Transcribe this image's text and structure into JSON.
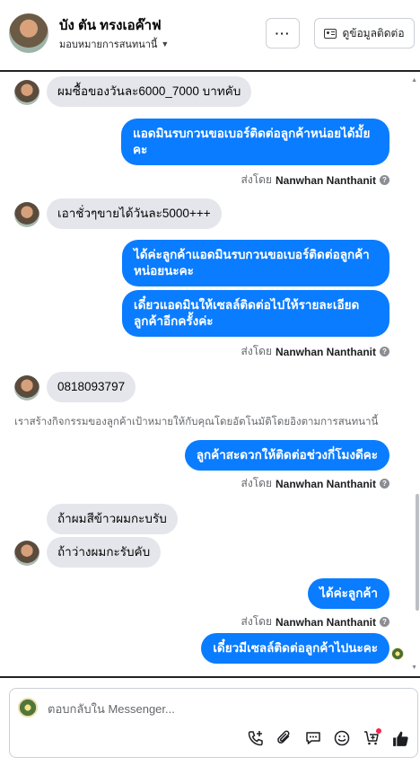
{
  "header": {
    "contact_name": "บัง ตัน ทรงเอค๊าฟ",
    "assign_label": "มอบหมายการสนทนานี้",
    "more_label": "···",
    "contact_info_label": "ดูข้อมูลติดต่อ"
  },
  "messages": [
    {
      "type": "in",
      "text": "ผมซื้อของวันละ6000_7000 บาทคับ"
    },
    {
      "type": "out",
      "lines": [
        "แอดมินรบกวนขอเบอร์ติดต่อลูกค้าหน่อยได้มั้ย",
        "คะ"
      ]
    },
    {
      "type": "sent_by",
      "prefix": "ส่งโดย",
      "name": "Nanwhan Nanthanit"
    },
    {
      "type": "in",
      "text": "เอาชั่วๆขายได้วันละ5000+++"
    },
    {
      "type": "out",
      "lines": [
        "ได้ค่ะลูกค้าแอดมินรบกวนขอเบอร์ติดต่อลูกค้า",
        "หน่อยนะคะ"
      ]
    },
    {
      "type": "out",
      "lines": [
        "เดี๋ยวแอดมินให้เซลล์ติดต่อไปให้รายละเอียด",
        "ลูกค้าอีกครั้งค่ะ"
      ]
    },
    {
      "type": "sent_by",
      "prefix": "ส่งโดย",
      "name": "Nanwhan Nanthanit"
    },
    {
      "type": "in",
      "text": "0818093797"
    },
    {
      "type": "system",
      "text": "เราสร้างกิจกรรมของลูกค้าเป้าหมายให้กับคุณโดยอัตโนมัติโดยอิงตามการสนทนานี้"
    },
    {
      "type": "out",
      "lines": [
        "ลูกค้าสะดวกให้ติดต่อช่วงกี่โมงดีคะ"
      ]
    },
    {
      "type": "sent_by",
      "prefix": "ส่งโดย",
      "name": "Nanwhan Nanthanit"
    },
    {
      "type": "in",
      "text": "ถ้าผมสีข้าวผมกะบรับ"
    },
    {
      "type": "in",
      "text": "ถ้าว่างผมกะรับคับ"
    },
    {
      "type": "out",
      "lines": [
        "ได้ค่ะลูกค้า"
      ]
    },
    {
      "type": "sent_by",
      "prefix": "ส่งโดย",
      "name": "Nanwhan Nanthanit"
    },
    {
      "type": "out",
      "lines": [
        "เดี๋ยวมีเซลล์ติดต่อลูกค้าไปนะคะ"
      ]
    }
  ],
  "composer": {
    "placeholder": "ตอบกลับใน Messenger..."
  },
  "icons": {
    "tools": [
      "add-call-icon",
      "attachment-icon",
      "saved-replies-icon",
      "emoji-icon",
      "add-to-cart-icon",
      "thumbs-up-icon"
    ]
  },
  "colors": {
    "outgoing_bubble": "#0a7cff",
    "incoming_bubble": "#e4e6eb",
    "notification_dot": "#f02849"
  }
}
